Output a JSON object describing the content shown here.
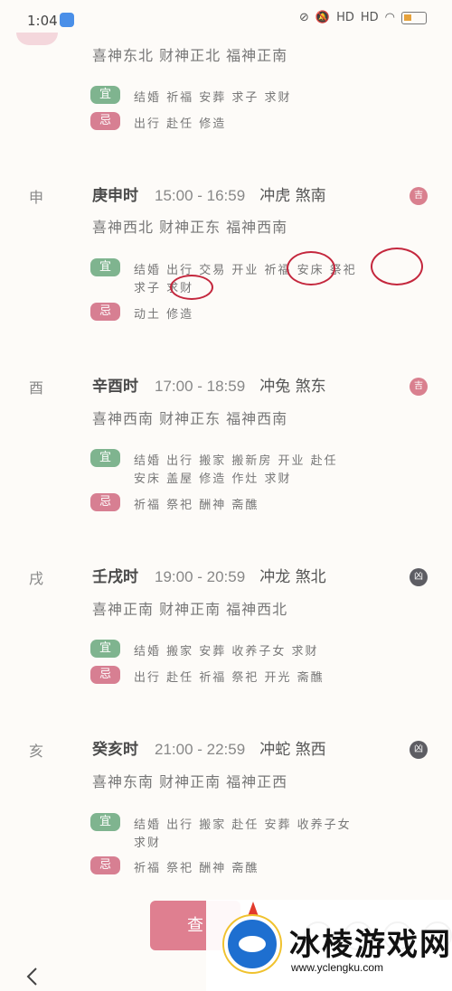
{
  "status": {
    "time": "1:04",
    "signal1": "HD",
    "signal2": "HD"
  },
  "top_block": {
    "gods": "喜神东北 财神正北 福神正南",
    "yi_label": "宜",
    "yi": "结婚 祈福 安葬 求子 求财",
    "ji_label": "忌",
    "ji": "出行 赴任 修造"
  },
  "hours": [
    {
      "branch": "申",
      "name": "庚申时",
      "time": "15:00 - 16:59",
      "clash": "冲虎 煞南",
      "gods": "喜神西北 财神正东 福神西南",
      "yi_label": "宜",
      "yi_line1": "结婚 出行 交易 开业 祈福 安床 祭祀",
      "yi_line2": "求子 求财",
      "ji_label": "忌",
      "ji": "动土 修造",
      "badge": "吉"
    },
    {
      "branch": "酉",
      "name": "辛酉时",
      "time": "17:00 - 18:59",
      "clash": "冲兔 煞东",
      "gods": "喜神西南 财神正东 福神西南",
      "yi_label": "宜",
      "yi_line1": "结婚 出行 搬家 搬新房 开业 赴任",
      "yi_line2": "安床 盖屋 修造 作灶 求财",
      "ji_label": "忌",
      "ji": "祈福 祭祀 酬神 斋醮",
      "badge": "吉"
    },
    {
      "branch": "戌",
      "name": "壬戌时",
      "time": "19:00 - 20:59",
      "clash": "冲龙 煞北",
      "gods": "喜神正南 财神正南 福神西北",
      "yi_label": "宜",
      "yi_line1": "结婚 搬家 安葬 收养子女 求财",
      "yi_line2": "",
      "ji_label": "忌",
      "ji": "出行 赴任 祈福 祭祀 开光 斋醮",
      "badge": "凶"
    },
    {
      "branch": "亥",
      "name": "癸亥时",
      "time": "21:00 - 22:59",
      "clash": "冲蛇 煞西",
      "gods": "喜神东南 财神正南 福神正西",
      "yi_label": "宜",
      "yi_line1": "结婚 出行 搬家 赴任 安葬 收养子女",
      "yi_line2": "求财",
      "ji_label": "忌",
      "ji": "祈福 祭祀 酬神 斋醮",
      "badge": "凶"
    }
  ],
  "bottom": {
    "check_label": "查"
  },
  "watermark": {
    "title": "冰棱游戏网",
    "url": "www.yclengku.com"
  },
  "colors": {
    "yi": "#7fb48f",
    "ji": "#d77f92",
    "good_badge": "#d9808f",
    "bad_badge": "#5d5d63",
    "annotation": "#c4273d"
  }
}
